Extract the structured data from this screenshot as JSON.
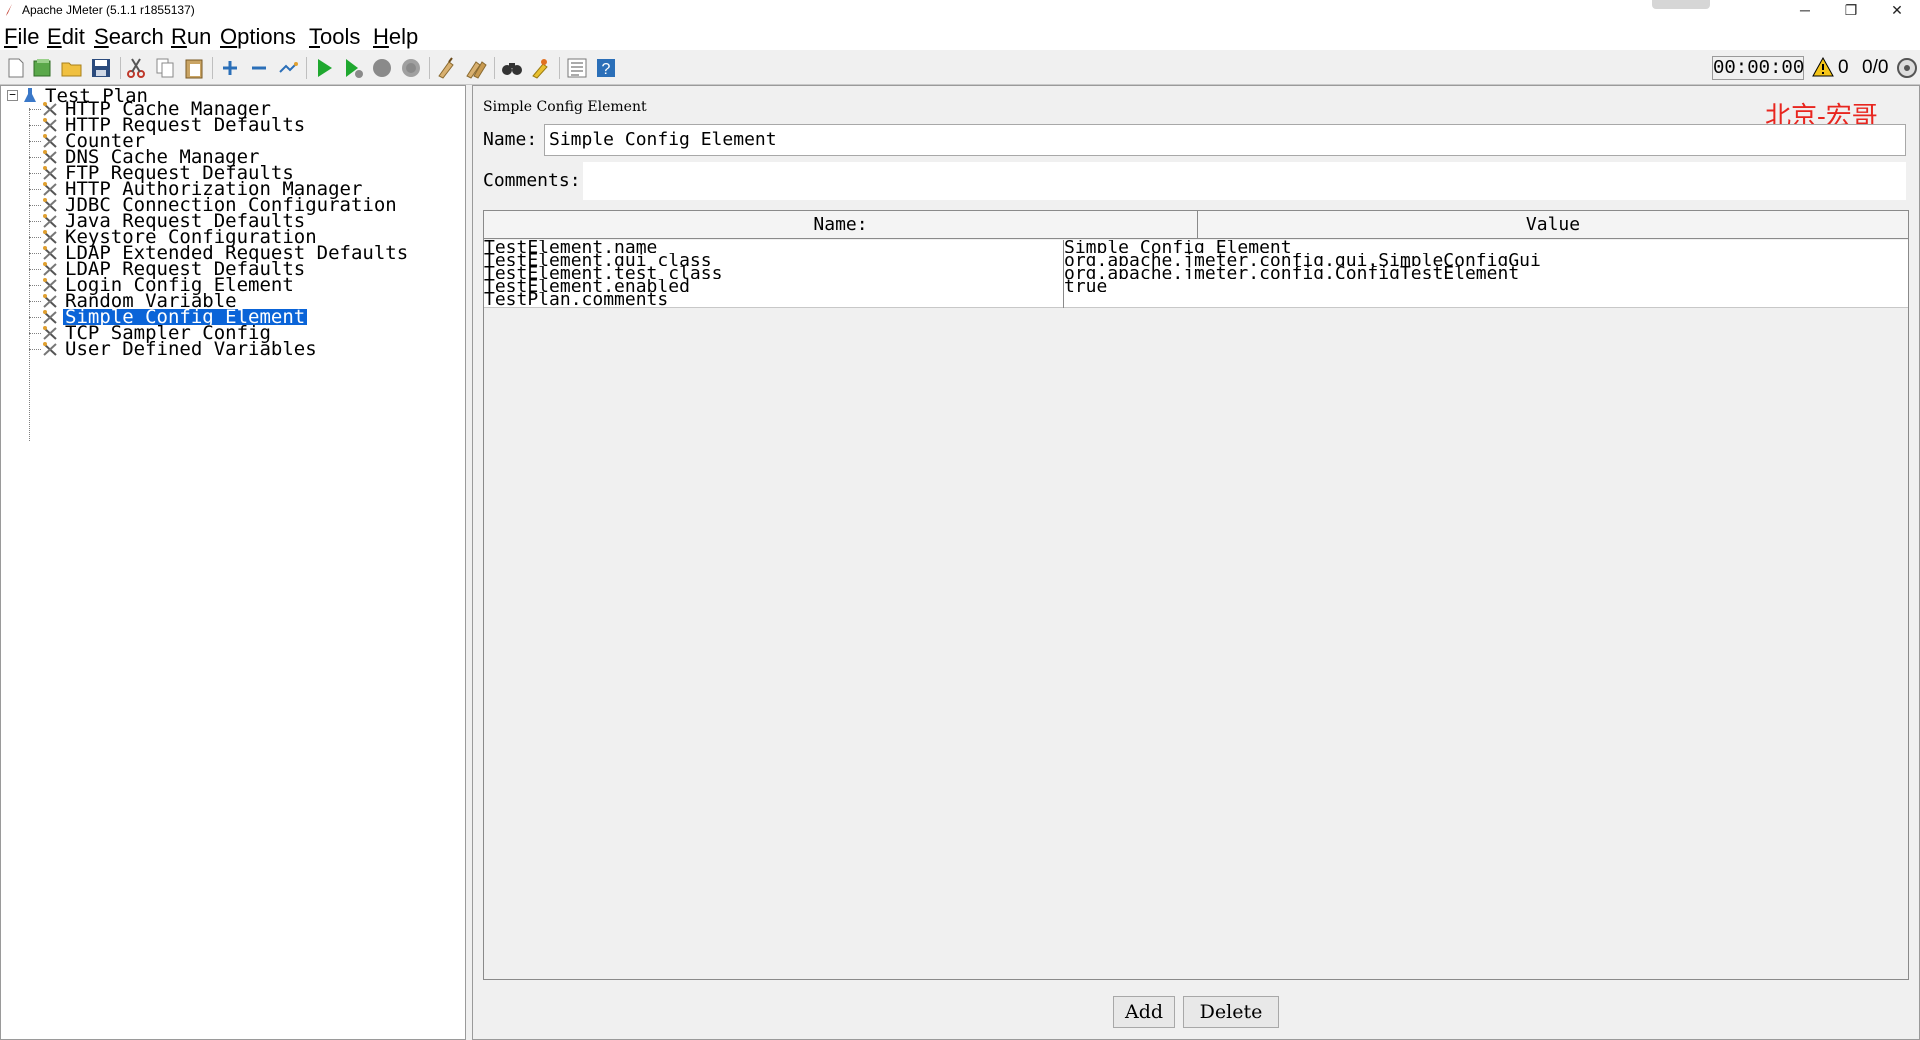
{
  "window": {
    "title": "Apache JMeter (5.1.1 r1855137)",
    "minimize_glyph": "─",
    "restore_glyph": "❐",
    "close_glyph": "✕"
  },
  "menubar": {
    "items": [
      {
        "label": "File",
        "mnemonic": "F",
        "rest": "ile"
      },
      {
        "label": "Edit",
        "mnemonic": "E",
        "rest": "dit"
      },
      {
        "label": "Search",
        "mnemonic": "S",
        "rest": "earch"
      },
      {
        "label": "Run",
        "mnemonic": "R",
        "rest": "un"
      },
      {
        "label": "Options",
        "mnemonic": "O",
        "rest": "ptions"
      },
      {
        "label": "Tools",
        "mnemonic": "T",
        "rest": "ools"
      },
      {
        "label": "Help",
        "mnemonic": "H",
        "rest": "elp"
      }
    ]
  },
  "toolbar": {
    "timer": "00:00:00",
    "error_count": "0",
    "thread_count": "0/0"
  },
  "tree": {
    "root": "Test Plan",
    "expander_glyph": "−",
    "items": [
      "HTTP Cache Manager",
      "HTTP Request Defaults",
      "Counter",
      "DNS Cache Manager",
      "FTP Request Defaults",
      "HTTP Authorization Manager",
      "JDBC Connection Configuration",
      "Java Request Defaults",
      "Keystore Configuration",
      "LDAP Extended Request Defaults",
      "LDAP Request Defaults",
      "Login Config Element",
      "Random Variable",
      "Simple Config Element",
      "TCP Sampler Config",
      "User Defined Variables"
    ],
    "selected": "Simple Config Element"
  },
  "panel": {
    "title": "Simple Config Element",
    "watermark": "北京-宏哥",
    "name_label": "Name:",
    "name_value": "Simple Config Element",
    "comments_label": "Comments:",
    "comments_value": "",
    "table": {
      "headers": [
        "Name:",
        "Value"
      ],
      "rows": [
        [
          "TestElement.name",
          "Simple Config Element"
        ],
        [
          "TestElement.gui_class",
          "org.apache.jmeter.config.gui.SimpleConfigGui"
        ],
        [
          "TestElement.test_class",
          "org.apache.jmeter.config.ConfigTestElement"
        ],
        [
          "TestElement.enabled",
          "true"
        ],
        [
          "TestPlan.comments",
          ""
        ]
      ]
    },
    "add_label": "Add",
    "delete_label": "Delete"
  }
}
